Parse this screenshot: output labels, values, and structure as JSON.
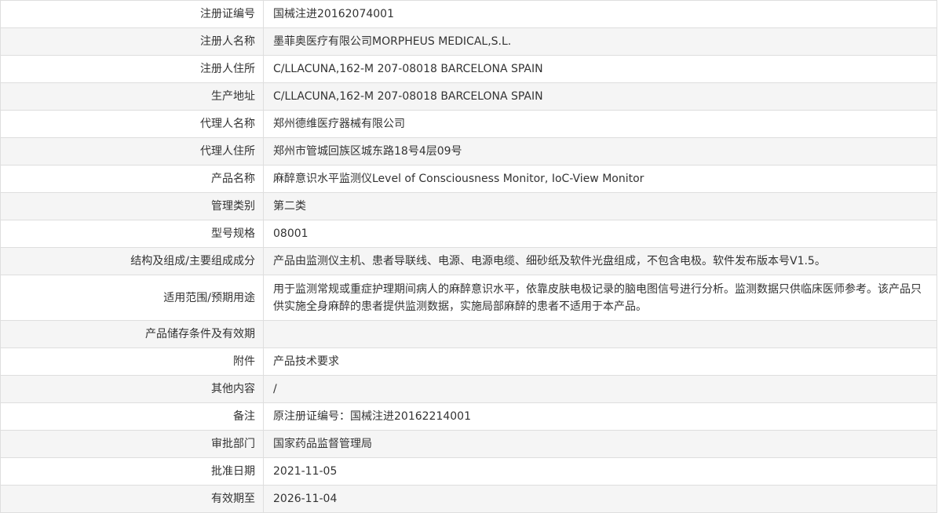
{
  "rows": [
    {
      "label": "注册证编号",
      "value": "国械注进20162074001"
    },
    {
      "label": "注册人名称",
      "value": "墨菲奥医疗有限公司MORPHEUS MEDICAL,S.L."
    },
    {
      "label": "注册人住所",
      "value": "C/LLACUNA,162-M 207-08018 BARCELONA SPAIN"
    },
    {
      "label": "生产地址",
      "value": "C/LLACUNA,162-M 207-08018 BARCELONA SPAIN"
    },
    {
      "label": "代理人名称",
      "value": "郑州德维医疗器械有限公司"
    },
    {
      "label": "代理人住所",
      "value": "郑州市管城回族区城东路18号4层09号"
    },
    {
      "label": "产品名称",
      "value": "麻醉意识水平监测仪Level of Consciousness Monitor, IoC-View Monitor"
    },
    {
      "label": "管理类别",
      "value": "第二类"
    },
    {
      "label": "型号规格",
      "value": "08001"
    },
    {
      "label": "结构及组成/主要组成成分",
      "value": "产品由监测仪主机、患者导联线、电源、电源电缆、细砂纸及软件光盘组成，不包含电极。软件发布版本号V1.5。"
    },
    {
      "label": "适用范围/预期用途",
      "value": "用于监测常规或重症护理期间病人的麻醉意识水平，依靠皮肤电极记录的脑电图信号进行分析。监测数据只供临床医师参考。该产品只供实施全身麻醉的患者提供监测数据，实施局部麻醉的患者不适用于本产品。"
    },
    {
      "label": "产品储存条件及有效期",
      "value": ""
    },
    {
      "label": "附件",
      "value": "产品技术要求"
    },
    {
      "label": "其他内容",
      "value": "/"
    },
    {
      "label": "备注",
      "value": "原注册证编号：国械注进20162214001"
    },
    {
      "label": "审批部门",
      "value": "国家药品监督管理局"
    },
    {
      "label": "批准日期",
      "value": "2021-11-05"
    },
    {
      "label": "有效期至",
      "value": "2026-11-04"
    }
  ]
}
